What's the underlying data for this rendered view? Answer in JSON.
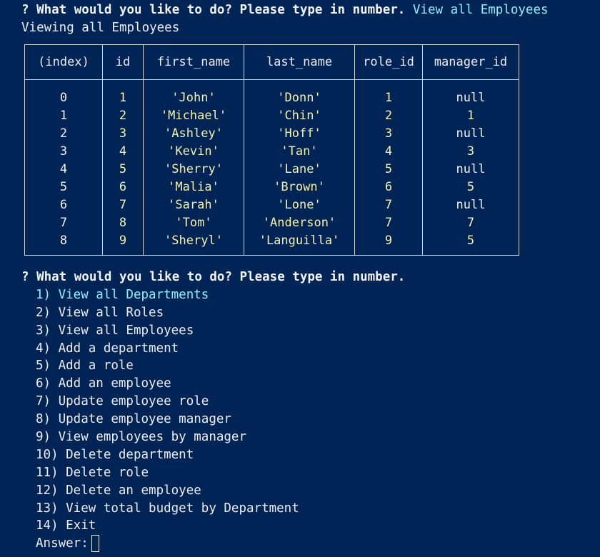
{
  "prompt1": {
    "question": "? What would you like to do? Please type in number.",
    "answer": "View all Employees"
  },
  "status": "Viewing all Employees",
  "table": {
    "headers": [
      "(index)",
      "id",
      "first_name",
      "last_name",
      "role_id",
      "manager_id"
    ],
    "rows": [
      [
        "0",
        "1",
        "'John'",
        "'Donn'",
        "1",
        "null"
      ],
      [
        "1",
        "2",
        "'Michael'",
        "'Chin'",
        "2",
        "1"
      ],
      [
        "2",
        "3",
        "'Ashley'",
        "'Hoff'",
        "3",
        "null"
      ],
      [
        "3",
        "4",
        "'Kevin'",
        "'Tan'",
        "4",
        "3"
      ],
      [
        "4",
        "5",
        "'Sherry'",
        "'Lane'",
        "5",
        "null"
      ],
      [
        "5",
        "6",
        "'Malia'",
        "'Brown'",
        "6",
        "5"
      ],
      [
        "6",
        "7",
        "'Sarah'",
        "'Lone'",
        "7",
        "null"
      ],
      [
        "7",
        "8",
        "'Tom'",
        "'Anderson'",
        "7",
        "7"
      ],
      [
        "8",
        "9",
        "'Sheryl'",
        "'Languilla'",
        "9",
        "5"
      ]
    ]
  },
  "prompt2": {
    "question": "? What would you like to do? Please type in number.",
    "options": [
      "1) View all Departments",
      "2) View all Roles",
      "3) View all Employees",
      "4) Add a department",
      "5) Add a role",
      "6) Add an employee",
      "7) Update employee role",
      "8) Update employee manager",
      "9) View employees by manager",
      "10) Delete department",
      "11) Delete role",
      "12) Delete an employee",
      "13) View total budget by Department",
      "14) Exit"
    ],
    "answer_label": "Answer:"
  },
  "colors": {
    "background": "#012456",
    "highlight": "#8ef0fb",
    "string": "#f5f1a8",
    "text": "#eeedf0"
  }
}
